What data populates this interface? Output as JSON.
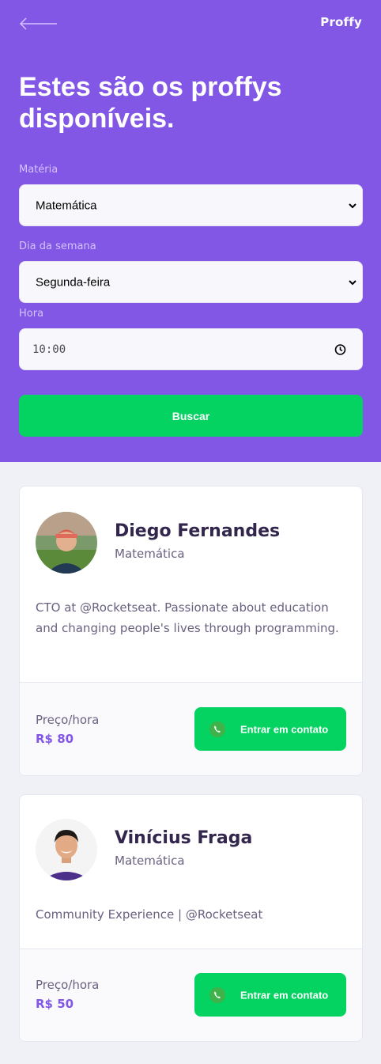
{
  "header": {
    "logo": "Proffy",
    "title": "Estes são os proffys disponíveis."
  },
  "filters": {
    "subject": {
      "label": "Matéria",
      "value": "Matemática"
    },
    "weekday": {
      "label": "Dia da semana",
      "value": "Segunda-feira"
    },
    "time": {
      "label": "Hora",
      "value": "10:00"
    },
    "search_label": "Buscar"
  },
  "teachers": [
    {
      "name": "Diego Fernandes",
      "subject": "Matemática",
      "bio": "CTO at @Rocketseat. Passionate about education and changing people's lives through programming.",
      "price_label": "Preço/hora",
      "price": "R$ 80",
      "contact_label": "Entrar em contato"
    },
    {
      "name": "Vinícius Fraga",
      "subject": "Matemática",
      "bio": "Community Experience | @Rocketseat",
      "price_label": "Preço/hora",
      "price": "R$ 50",
      "contact_label": "Entrar em contato"
    }
  ],
  "icons": {
    "back": "arrow-left-icon",
    "select": "chevron-down-icon",
    "time": "clock-icon",
    "contact": "whatsapp-icon"
  },
  "colors": {
    "primary": "#8257e5",
    "secondary": "#04d361",
    "background": "#f0f0f7",
    "title_dark": "#32264d",
    "text_base": "#6a6180"
  }
}
